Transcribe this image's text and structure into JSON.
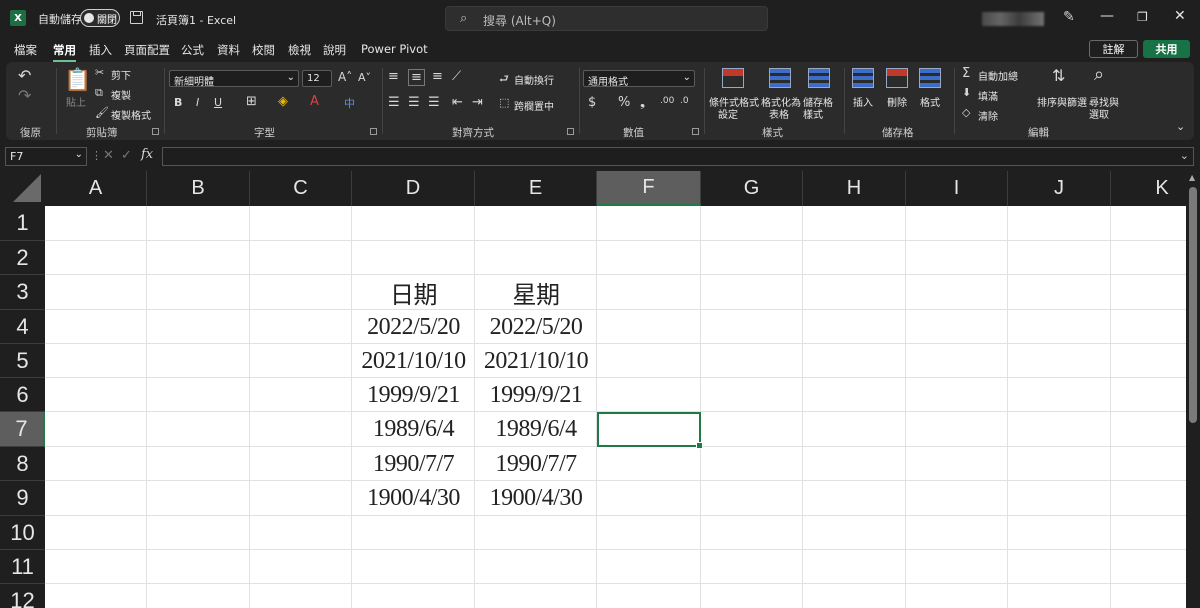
{
  "titlebar": {
    "autosave_label": "自動儲存",
    "toggle_state": "關閉",
    "doc_title": "活頁簿1  -  Excel",
    "search_placeholder": "搜尋 (Alt+Q)"
  },
  "menu_tabs": [
    "檔案",
    "常用",
    "插入",
    "頁面配置",
    "公式",
    "資料",
    "校閱",
    "檢視",
    "說明",
    "Power Pivot"
  ],
  "active_tab": "常用",
  "actions": {
    "comment": "註解",
    "share": "共用"
  },
  "ribbon": {
    "groups": {
      "undo": "復原",
      "clipboard": "剪貼簿",
      "font": "字型",
      "alignment": "對齊方式",
      "number": "數值",
      "styles": "樣式",
      "cells": "儲存格",
      "editing": "編輯"
    },
    "clipboard": {
      "cut": "剪下",
      "copy": "複製",
      "paste": "貼上",
      "format_painter": "複製格式"
    },
    "font": {
      "name": "新細明體",
      "size": "12"
    },
    "alignment": {
      "wrap": "自動換行",
      "merge": "跨欄置中"
    },
    "number": {
      "format": "通用格式"
    },
    "styles": {
      "conditional": "條件式格式",
      "conditional2": "設定",
      "as_table": "格式化為",
      "as_table2": "表格",
      "cell_styles": "儲存格",
      "cell_styles2": "樣式"
    },
    "cells": {
      "insert": "插入",
      "delete": "刪除",
      "format": "格式"
    },
    "editing": {
      "autosum": "自動加總",
      "fill": "填滿",
      "clear": "清除",
      "sort": "排序與篩選",
      "find": "尋找與",
      "find2": "選取"
    }
  },
  "formula_bar": {
    "name_box": "F7",
    "fx": "fx",
    "value": ""
  },
  "grid": {
    "columns": [
      "A",
      "B",
      "C",
      "D",
      "E",
      "F",
      "G",
      "H",
      "I",
      "J",
      "K"
    ],
    "rows": [
      "1",
      "2",
      "3",
      "4",
      "5",
      "6",
      "7",
      "8",
      "9",
      "10",
      "11",
      "12"
    ],
    "selected_column": "F",
    "selected_row": "7",
    "cells": {
      "D3": "日期",
      "E3": "星期",
      "D4": "2022/5/20",
      "E4": "2022/5/20",
      "D5": "2021/10/10",
      "E5": "2021/10/10",
      "D6": "1999/9/21",
      "E6": "1999/9/21",
      "D7": "1989/6/4",
      "E7": "1989/6/4",
      "D8": "1990/7/7",
      "E8": "1990/7/7",
      "D9": "1900/4/30",
      "E9": "1900/4/30"
    }
  },
  "colors": {
    "accent": "#1f7a45",
    "ribbon_bg": "#2b2b2b",
    "chrome_bg": "#1f1f1f"
  }
}
